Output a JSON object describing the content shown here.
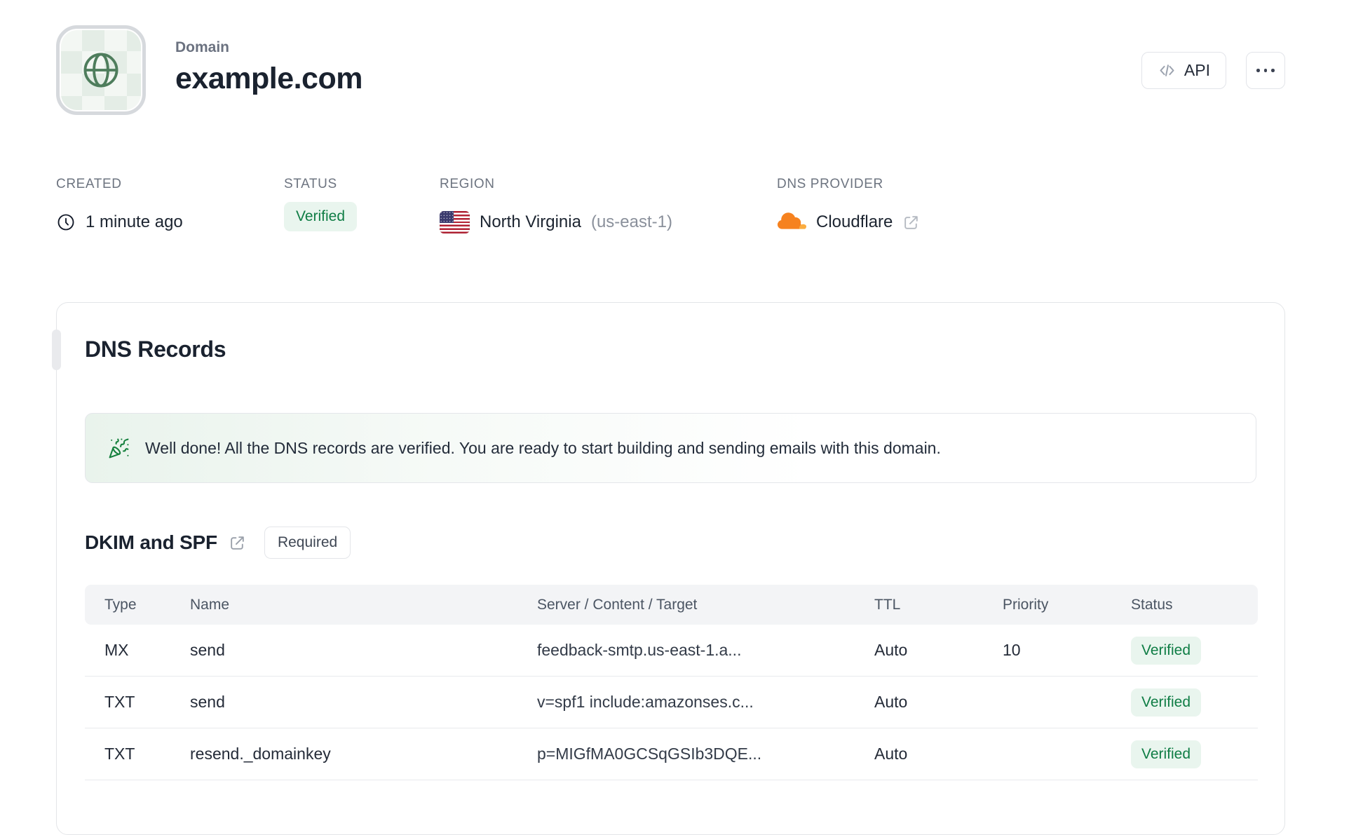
{
  "header": {
    "kicker": "Domain",
    "title": "example.com",
    "api_button_label": "API"
  },
  "meta": {
    "created": {
      "label": "CREATED",
      "value": "1 minute ago"
    },
    "status": {
      "label": "STATUS",
      "value": "Verified"
    },
    "region": {
      "label": "REGION",
      "value": "North Virginia",
      "code": "(us-east-1)"
    },
    "dns_provider": {
      "label": "DNS PROVIDER",
      "value": "Cloudflare"
    }
  },
  "dns_card": {
    "title": "DNS Records",
    "banner_text": "Well done! All the DNS records are verified. You are ready to start building and sending emails with this domain.",
    "section": {
      "title": "DKIM and SPF",
      "badge": "Required"
    },
    "table": {
      "headers": [
        "Type",
        "Name",
        "Server / Content / Target",
        "TTL",
        "Priority",
        "Status"
      ],
      "rows": [
        {
          "type": "MX",
          "name": "send",
          "content": "feedback-smtp.us-east-1.a...",
          "ttl": "Auto",
          "priority": "10",
          "status": "Verified"
        },
        {
          "type": "TXT",
          "name": "send",
          "content": "v=spf1 include:amazonses.c...",
          "ttl": "Auto",
          "priority": "",
          "status": "Verified"
        },
        {
          "type": "TXT",
          "name": "resend._domainkey",
          "content": "p=MIGfMA0GCSqGSIb3DQE...",
          "ttl": "Auto",
          "priority": "",
          "status": "Verified"
        }
      ]
    }
  },
  "icons": {
    "avatar": "globe-icon",
    "created": "clock-icon",
    "region": "us-flag-icon",
    "provider": "cloudflare-icon",
    "banner": "party-popper-icon",
    "api": "code-icon",
    "more": "ellipsis-icon",
    "external": "external-link-icon"
  },
  "colors": {
    "verified_text": "#0f7d45",
    "verified_bg": "#e9f5ee",
    "success_icon_green": "#15803d",
    "banner_tint": "#e9f3ec",
    "cloudflare_orange": "#f6821f",
    "cloudflare_light": "#fbad41",
    "heading_dark": "#1a222f",
    "muted_gray": "#6d7480",
    "border_gray": "#e3e5e8",
    "table_header_bg": "#f3f4f6"
  }
}
